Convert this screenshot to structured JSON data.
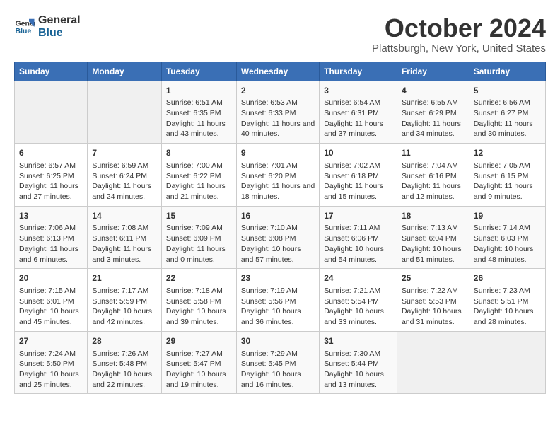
{
  "header": {
    "logo_line1": "General",
    "logo_line2": "Blue",
    "month": "October 2024",
    "location": "Plattsburgh, New York, United States"
  },
  "days_of_week": [
    "Sunday",
    "Monday",
    "Tuesday",
    "Wednesday",
    "Thursday",
    "Friday",
    "Saturday"
  ],
  "weeks": [
    [
      {
        "day": "",
        "content": ""
      },
      {
        "day": "",
        "content": ""
      },
      {
        "day": "1",
        "content": "Sunrise: 6:51 AM\nSunset: 6:35 PM\nDaylight: 11 hours and 43 minutes."
      },
      {
        "day": "2",
        "content": "Sunrise: 6:53 AM\nSunset: 6:33 PM\nDaylight: 11 hours and 40 minutes."
      },
      {
        "day": "3",
        "content": "Sunrise: 6:54 AM\nSunset: 6:31 PM\nDaylight: 11 hours and 37 minutes."
      },
      {
        "day": "4",
        "content": "Sunrise: 6:55 AM\nSunset: 6:29 PM\nDaylight: 11 hours and 34 minutes."
      },
      {
        "day": "5",
        "content": "Sunrise: 6:56 AM\nSunset: 6:27 PM\nDaylight: 11 hours and 30 minutes."
      }
    ],
    [
      {
        "day": "6",
        "content": "Sunrise: 6:57 AM\nSunset: 6:25 PM\nDaylight: 11 hours and 27 minutes."
      },
      {
        "day": "7",
        "content": "Sunrise: 6:59 AM\nSunset: 6:24 PM\nDaylight: 11 hours and 24 minutes."
      },
      {
        "day": "8",
        "content": "Sunrise: 7:00 AM\nSunset: 6:22 PM\nDaylight: 11 hours and 21 minutes."
      },
      {
        "day": "9",
        "content": "Sunrise: 7:01 AM\nSunset: 6:20 PM\nDaylight: 11 hours and 18 minutes."
      },
      {
        "day": "10",
        "content": "Sunrise: 7:02 AM\nSunset: 6:18 PM\nDaylight: 11 hours and 15 minutes."
      },
      {
        "day": "11",
        "content": "Sunrise: 7:04 AM\nSunset: 6:16 PM\nDaylight: 11 hours and 12 minutes."
      },
      {
        "day": "12",
        "content": "Sunrise: 7:05 AM\nSunset: 6:15 PM\nDaylight: 11 hours and 9 minutes."
      }
    ],
    [
      {
        "day": "13",
        "content": "Sunrise: 7:06 AM\nSunset: 6:13 PM\nDaylight: 11 hours and 6 minutes."
      },
      {
        "day": "14",
        "content": "Sunrise: 7:08 AM\nSunset: 6:11 PM\nDaylight: 11 hours and 3 minutes."
      },
      {
        "day": "15",
        "content": "Sunrise: 7:09 AM\nSunset: 6:09 PM\nDaylight: 11 hours and 0 minutes."
      },
      {
        "day": "16",
        "content": "Sunrise: 7:10 AM\nSunset: 6:08 PM\nDaylight: 10 hours and 57 minutes."
      },
      {
        "day": "17",
        "content": "Sunrise: 7:11 AM\nSunset: 6:06 PM\nDaylight: 10 hours and 54 minutes."
      },
      {
        "day": "18",
        "content": "Sunrise: 7:13 AM\nSunset: 6:04 PM\nDaylight: 10 hours and 51 minutes."
      },
      {
        "day": "19",
        "content": "Sunrise: 7:14 AM\nSunset: 6:03 PM\nDaylight: 10 hours and 48 minutes."
      }
    ],
    [
      {
        "day": "20",
        "content": "Sunrise: 7:15 AM\nSunset: 6:01 PM\nDaylight: 10 hours and 45 minutes."
      },
      {
        "day": "21",
        "content": "Sunrise: 7:17 AM\nSunset: 5:59 PM\nDaylight: 10 hours and 42 minutes."
      },
      {
        "day": "22",
        "content": "Sunrise: 7:18 AM\nSunset: 5:58 PM\nDaylight: 10 hours and 39 minutes."
      },
      {
        "day": "23",
        "content": "Sunrise: 7:19 AM\nSunset: 5:56 PM\nDaylight: 10 hours and 36 minutes."
      },
      {
        "day": "24",
        "content": "Sunrise: 7:21 AM\nSunset: 5:54 PM\nDaylight: 10 hours and 33 minutes."
      },
      {
        "day": "25",
        "content": "Sunrise: 7:22 AM\nSunset: 5:53 PM\nDaylight: 10 hours and 31 minutes."
      },
      {
        "day": "26",
        "content": "Sunrise: 7:23 AM\nSunset: 5:51 PM\nDaylight: 10 hours and 28 minutes."
      }
    ],
    [
      {
        "day": "27",
        "content": "Sunrise: 7:24 AM\nSunset: 5:50 PM\nDaylight: 10 hours and 25 minutes."
      },
      {
        "day": "28",
        "content": "Sunrise: 7:26 AM\nSunset: 5:48 PM\nDaylight: 10 hours and 22 minutes."
      },
      {
        "day": "29",
        "content": "Sunrise: 7:27 AM\nSunset: 5:47 PM\nDaylight: 10 hours and 19 minutes."
      },
      {
        "day": "30",
        "content": "Sunrise: 7:29 AM\nSunset: 5:45 PM\nDaylight: 10 hours and 16 minutes."
      },
      {
        "day": "31",
        "content": "Sunrise: 7:30 AM\nSunset: 5:44 PM\nDaylight: 10 hours and 13 minutes."
      },
      {
        "day": "",
        "content": ""
      },
      {
        "day": "",
        "content": ""
      }
    ]
  ]
}
